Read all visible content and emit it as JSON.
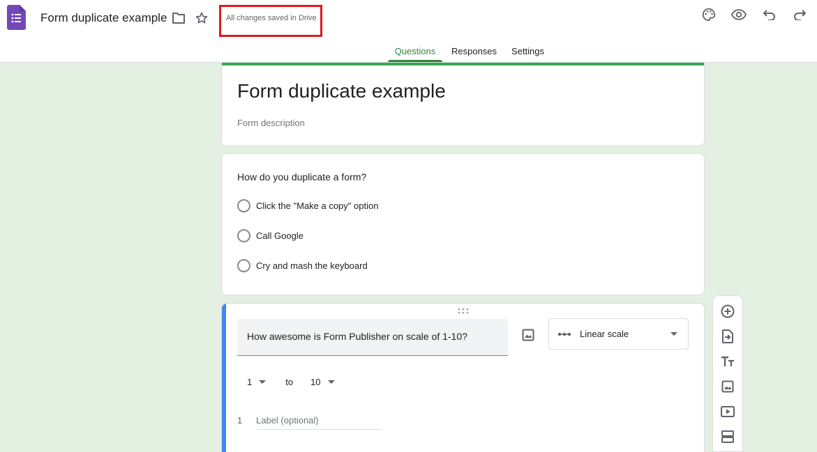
{
  "header": {
    "doc_title": "Form duplicate example",
    "save_status": "All changes saved in Drive",
    "icons": [
      "forms-app-icon",
      "folder-icon",
      "star-icon",
      "palette-icon",
      "preview-icon",
      "undo-icon",
      "redo-icon"
    ]
  },
  "tabs": [
    {
      "label": "Questions",
      "active": true
    },
    {
      "label": "Responses",
      "active": false
    },
    {
      "label": "Settings",
      "active": false
    }
  ],
  "form": {
    "title": "Form duplicate example",
    "description_placeholder": "Form description"
  },
  "question1": {
    "text": "How do you duplicate a form?",
    "options": [
      "Click the \"Make a copy\" option",
      "Call Google",
      "Cry and mash the keyboard"
    ]
  },
  "question2": {
    "text": "How awesome is Form Publisher on scale of 1-10?",
    "type": "Linear scale",
    "scale_from": "1",
    "scale_to_word": "to",
    "scale_to": "10",
    "label_index": "1",
    "label_placeholder": "Label (optional)"
  },
  "side_toolbar": [
    "add-question-icon",
    "import-questions-icon",
    "add-title-icon",
    "add-image-icon",
    "add-video-icon",
    "add-section-icon"
  ],
  "colors": {
    "accent_green": "#34a853",
    "tab_active": "#33843d",
    "background": "#e3f0e2",
    "active_card_border": "#4285f4",
    "highlight_box": "#e0191f",
    "forms_purple": "#7248b9"
  }
}
